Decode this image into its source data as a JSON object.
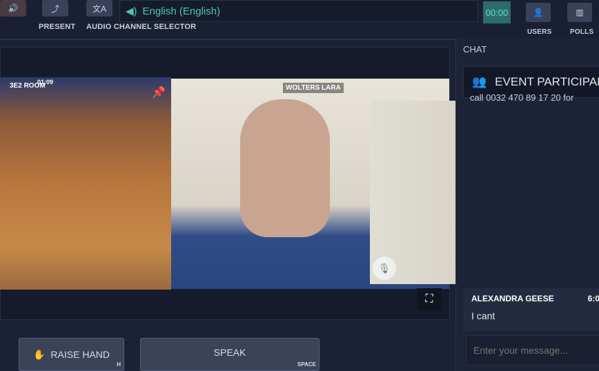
{
  "toolbar": {
    "present_label": "PRESENT",
    "audio_channel_label": "AUDIO CHANNEL SELECTOR",
    "language": "English (English)",
    "timer": "00:00",
    "users_label": "USERS",
    "polls_label": "POLLS"
  },
  "videos": {
    "room_label": "3E2 ROOM",
    "room_time": "01:09",
    "speaker_name": "WOLTERS LARA"
  },
  "chat": {
    "title": "CHAT",
    "participants_label": "EVENT PARTICIPANTS",
    "partial_message": "call 0032 470 89 17 20 for",
    "messages": [
      {
        "author": "ALEXANDRA GEESE",
        "time": "6:0",
        "text": "I cant"
      }
    ],
    "input_placeholder": "Enter your message..."
  },
  "actions": {
    "raise_hand_label": "RAISE HAND",
    "raise_hand_key": "H",
    "speak_label": "SPEAK",
    "speak_key": "SPACE"
  },
  "colors": {
    "accent": "#4fc7b3",
    "hangup": "#e8502a",
    "background": "#1c2236"
  }
}
